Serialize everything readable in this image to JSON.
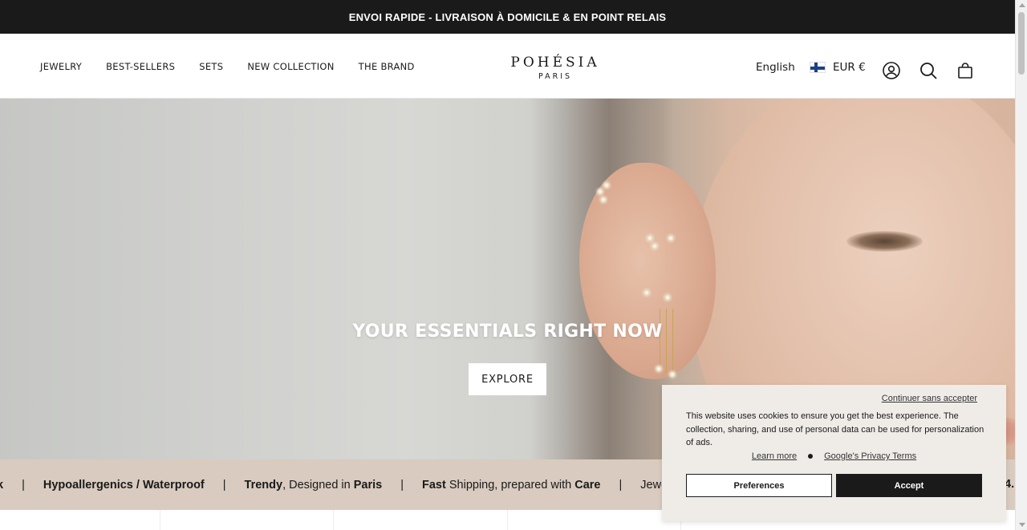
{
  "announcement": "ENVOI RAPIDE - LIVRAISON À DOMICILE & EN POINT RELAIS",
  "nav": {
    "items": [
      "JEWELRY",
      "BEST-SELLERS",
      "SETS",
      "NEW COLLECTION",
      "THE BRAND"
    ]
  },
  "brand": {
    "name": "POHÉSIA",
    "sub": "PARIS"
  },
  "header": {
    "language": "English",
    "currency": "EUR €",
    "currency_flag": "finland-flag-icon",
    "icons": [
      "account-icon",
      "search-icon",
      "cart-icon"
    ]
  },
  "hero": {
    "title": "YOUR ESSENTIALS RIGHT NOW",
    "cta": "EXPLORE"
  },
  "ticker": {
    "items": [
      {
        "bold": "k",
        "rest": ""
      },
      {
        "bold": "Hypoallergenics / Waterproof",
        "rest": ""
      },
      {
        "bold": "Trendy",
        "rest": ", Designed in ",
        "bold2": "Paris"
      },
      {
        "bold": "Fast",
        "rest": " Shipping, prepared with ",
        "bold2": "Care"
      },
      {
        "bold": "",
        "rest": "Jewe"
      },
      {
        "bold": "4.",
        "rest": ""
      }
    ]
  },
  "cookie": {
    "skip": "Continuer sans accepter",
    "message": "This website uses cookies to ensure you get the best experience. The collection, sharing, and use of personal data can be used for personalization of ads.",
    "learn_more": "Learn more",
    "privacy": "Google's Privacy Terms",
    "preferences": "Preferences",
    "accept": "Accept"
  },
  "colors": {
    "announcement_bg": "#1a1a1a",
    "ticker_bg": "#d9cbbf",
    "cookie_bg": "#efece8",
    "accent": "#1a1a1a"
  }
}
